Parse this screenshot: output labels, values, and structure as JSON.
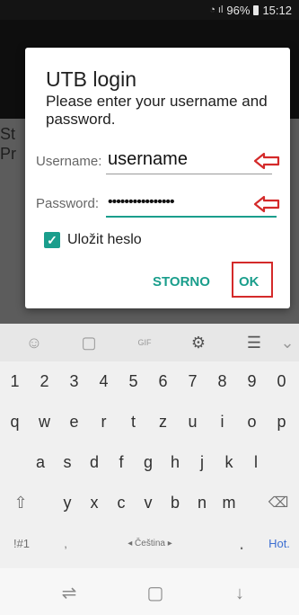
{
  "status_bar": {
    "signal": "📶",
    "battery": "96%",
    "time": "15:12"
  },
  "app_background": {
    "partial_text_lines": [
      "St",
      "Pr"
    ]
  },
  "dialog": {
    "title": "UTB login",
    "message": "Please enter your username and password.",
    "username_label": "Username:",
    "username_value": "username",
    "password_label": "Password:",
    "password_value": "••••••••••••••••",
    "checkbox_label": "Uložit heslo",
    "checkbox_checked": true,
    "cancel_label": "STORNO",
    "ok_label": "OK",
    "annotation_color": "#d42a2a"
  },
  "keyboard": {
    "toolbar_icons": [
      "smiley-icon",
      "sticker-icon",
      "gif-icon",
      "gear-icon",
      "clipboard-icon",
      "chevron-down-icon"
    ],
    "rows": [
      [
        "1",
        "2",
        "3",
        "4",
        "5",
        "6",
        "7",
        "8",
        "9",
        "0"
      ],
      [
        "q",
        "w",
        "e",
        "r",
        "t",
        "z",
        "u",
        "i",
        "o",
        "p"
      ],
      [
        "a",
        "s",
        "d",
        "f",
        "g",
        "h",
        "j",
        "k",
        "l"
      ],
      [
        "y",
        "x",
        "c",
        "v",
        "b",
        "n",
        "m"
      ]
    ],
    "symbols_label": "!#1",
    "comma_label": ",",
    "space_label": "◂ Čeština ▸",
    "period_label": ".",
    "action_label": "Hot."
  },
  "colors": {
    "accent": "#1a9e8c",
    "annotation": "#d42a2a"
  }
}
